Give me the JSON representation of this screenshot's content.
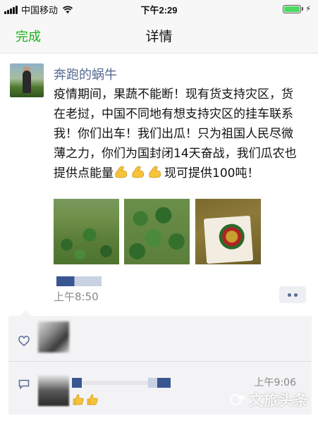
{
  "status_bar": {
    "carrier": "中国移动",
    "time": "下午2:29",
    "battery_level": 1.0
  },
  "nav": {
    "done_label": "完成",
    "title": "详情"
  },
  "post": {
    "author": "奔跑的蜗牛",
    "text": "疫情期间，果蔬不能断！现有货支持灾区，货在老挝，中国不同地有想支持灾区的挂车联系我！你们出车！我们出瓜！只为祖国人民尽微薄之力，你们为国封闭14天奋战，我们瓜农也提供点能量",
    "text_tail": "现可提供100吨！",
    "emoji_count": 3,
    "time": "上午8:50",
    "photos": [
      "watermelon-field-photo",
      "watermelon-closeup-photo",
      "watermelon-label-photo"
    ]
  },
  "interactions": {
    "comment_time": "上午9:06"
  },
  "watermark": {
    "text": "文旅头条"
  },
  "colors": {
    "accent_green": "#1aad19",
    "author_blue": "#576b95",
    "muted_gray": "#888888",
    "panel_bg": "#f3f3f5",
    "emoji_yellow": "#f6c33a"
  }
}
